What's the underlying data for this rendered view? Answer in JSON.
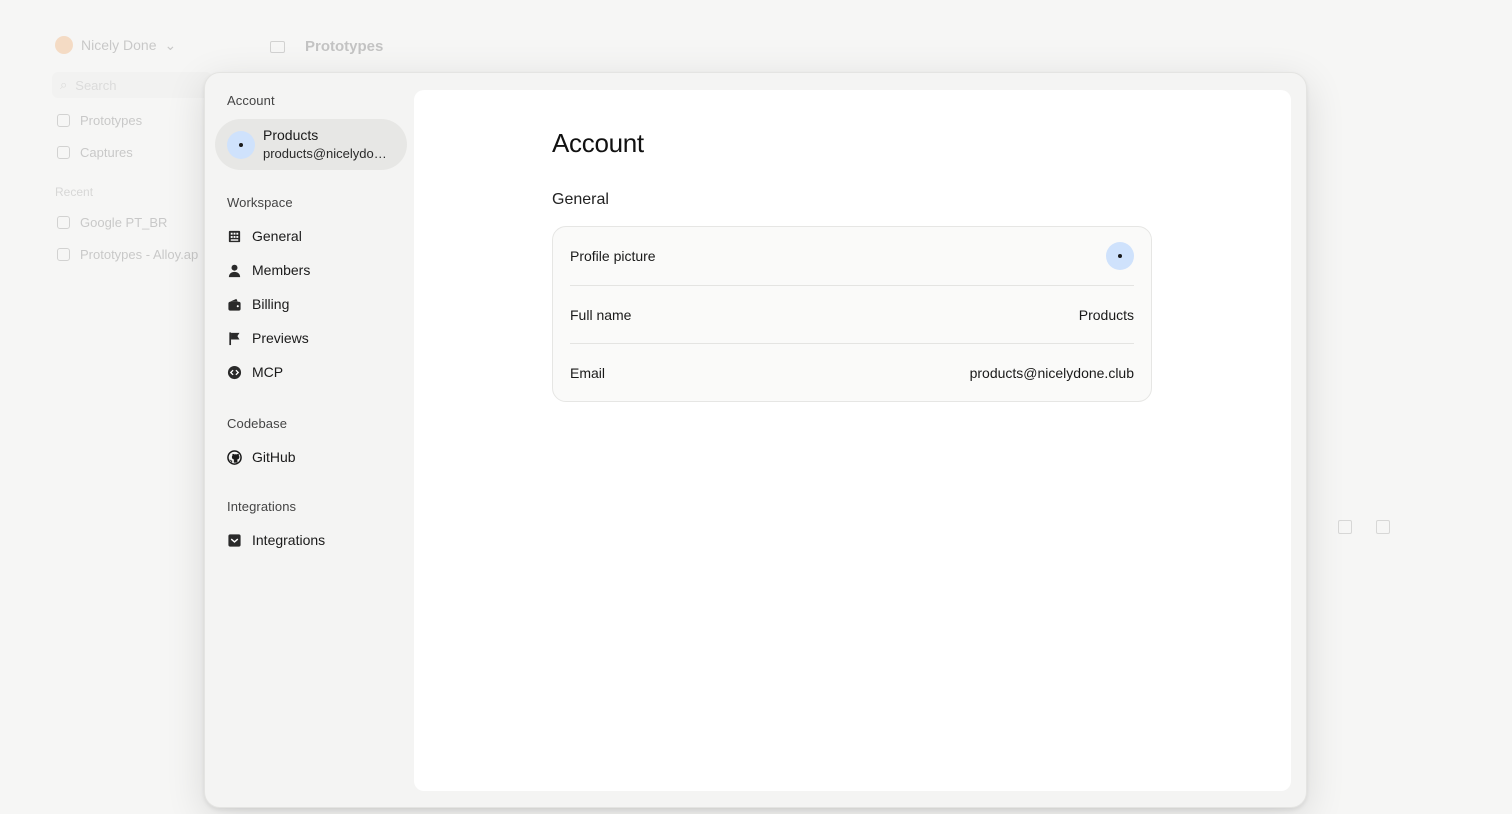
{
  "background": {
    "workspace_name": "Nicely Done",
    "search_placeholder": "Search",
    "nav": [
      "Prototypes",
      "Captures"
    ],
    "recent_header": "Recent",
    "recent_items": [
      "Google PT_BR",
      "Prototypes - Alloy.ap"
    ],
    "page_title": "Prototypes"
  },
  "sidebar": {
    "account_header": "Account",
    "account": {
      "name": "Products",
      "email": "products@nicelydon..."
    },
    "workspace_header": "Workspace",
    "workspace_items": [
      {
        "label": "General",
        "icon": "building-icon"
      },
      {
        "label": "Members",
        "icon": "person-icon"
      },
      {
        "label": "Billing",
        "icon": "wallet-icon"
      },
      {
        "label": "Previews",
        "icon": "flag-icon"
      },
      {
        "label": "MCP",
        "icon": "code-circle-icon"
      }
    ],
    "codebase_header": "Codebase",
    "codebase_items": [
      {
        "label": "GitHub",
        "icon": "github-icon"
      }
    ],
    "integrations_header": "Integrations",
    "integrations_items": [
      {
        "label": "Integrations",
        "icon": "inbox-icon"
      }
    ]
  },
  "content": {
    "title": "Account",
    "section": "General",
    "rows": [
      {
        "label": "Profile picture",
        "value": ""
      },
      {
        "label": "Full name",
        "value": "Products"
      },
      {
        "label": "Email",
        "value": "products@nicelydone.club"
      }
    ]
  },
  "colors": {
    "avatar_bg": "#cfe2fc",
    "modal_bg": "#f4f4f3",
    "card_bg": "#fafaf9"
  }
}
